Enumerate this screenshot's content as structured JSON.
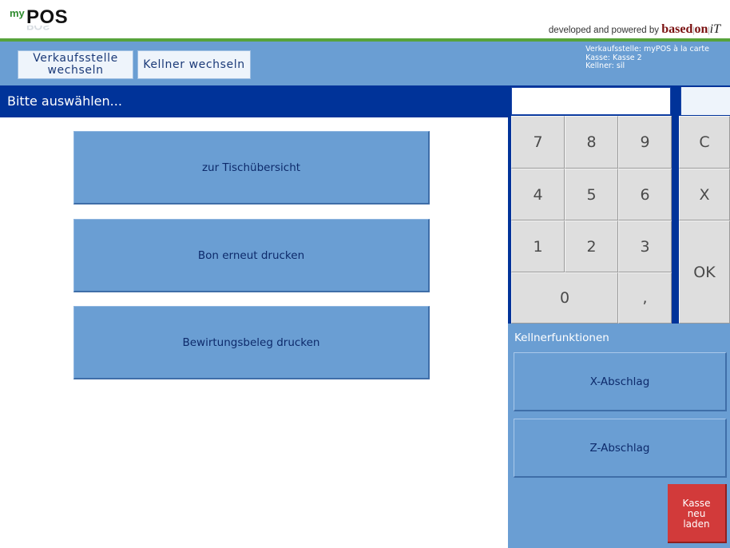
{
  "header": {
    "logo_prefix": "my",
    "logo_main": "POS",
    "powered_by_text": "developed and powered by",
    "brand_based": "based",
    "brand_on": "on",
    "brand_it": "iT"
  },
  "toolbar": {
    "change_store_label": "Verkaufsstelle wechseln",
    "change_waiter_label": "Kellner wechseln",
    "info_store": "Verkaufsstelle: myPOS à la carte",
    "info_register": "Kasse: Kasse 2",
    "info_waiter": "Kellner: sil"
  },
  "prompt": {
    "title": "Bitte auswählen..."
  },
  "actions": [
    {
      "label": "zur Tischübersicht"
    },
    {
      "label": "Bon erneut drucken"
    },
    {
      "label": "Bewirtungsbeleg drucken"
    }
  ],
  "numpad": {
    "display_value": "",
    "keys": {
      "k7": "7",
      "k8": "8",
      "k9": "9",
      "clear": "C",
      "k4": "4",
      "k5": "5",
      "k6": "6",
      "cancel": "X",
      "k1": "1",
      "k2": "2",
      "k3": "3",
      "ok": "OK",
      "k0": "0",
      "comma": ","
    }
  },
  "waiter_functions": {
    "title": "Kellnerfunktionen",
    "x_report_label": "X-Abschlag",
    "z_report_label": "Z-Abschlag",
    "reload_label": "Kasse\nneu\nladen"
  },
  "colors": {
    "toolbar_blue": "#6a9ed3",
    "dark_blue": "#003399",
    "accent_green": "#57a33b",
    "reload_red": "#d23a3a"
  }
}
